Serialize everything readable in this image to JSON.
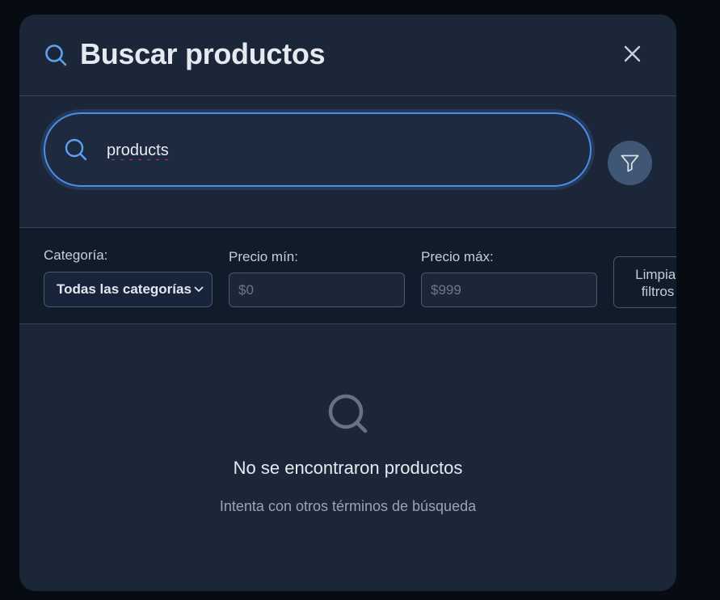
{
  "modal": {
    "title": "Buscar productos",
    "title_icon": "search-icon",
    "close_icon": "close-icon"
  },
  "search": {
    "value": "products",
    "icon": "search-icon",
    "filter_icon": "filter-funnel-icon"
  },
  "filters": {
    "category_label": "Categoría:",
    "category_selected": "Todas las categorías",
    "min_price_label": "Precio mín:",
    "min_price_placeholder": "$0",
    "max_price_label": "Precio máx:",
    "max_price_placeholder": "$999",
    "clear_line1": "Limpiar",
    "clear_line2": "filtros"
  },
  "empty_state": {
    "icon": "search-icon",
    "title": "No se encontraron productos",
    "subtitle": "Intenta con otros términos de búsqueda"
  },
  "colors": {
    "backdrop": "#070b12",
    "modal_bg": "#1c2639",
    "accent": "#4c8dea",
    "filter_button": "#3f5675"
  }
}
